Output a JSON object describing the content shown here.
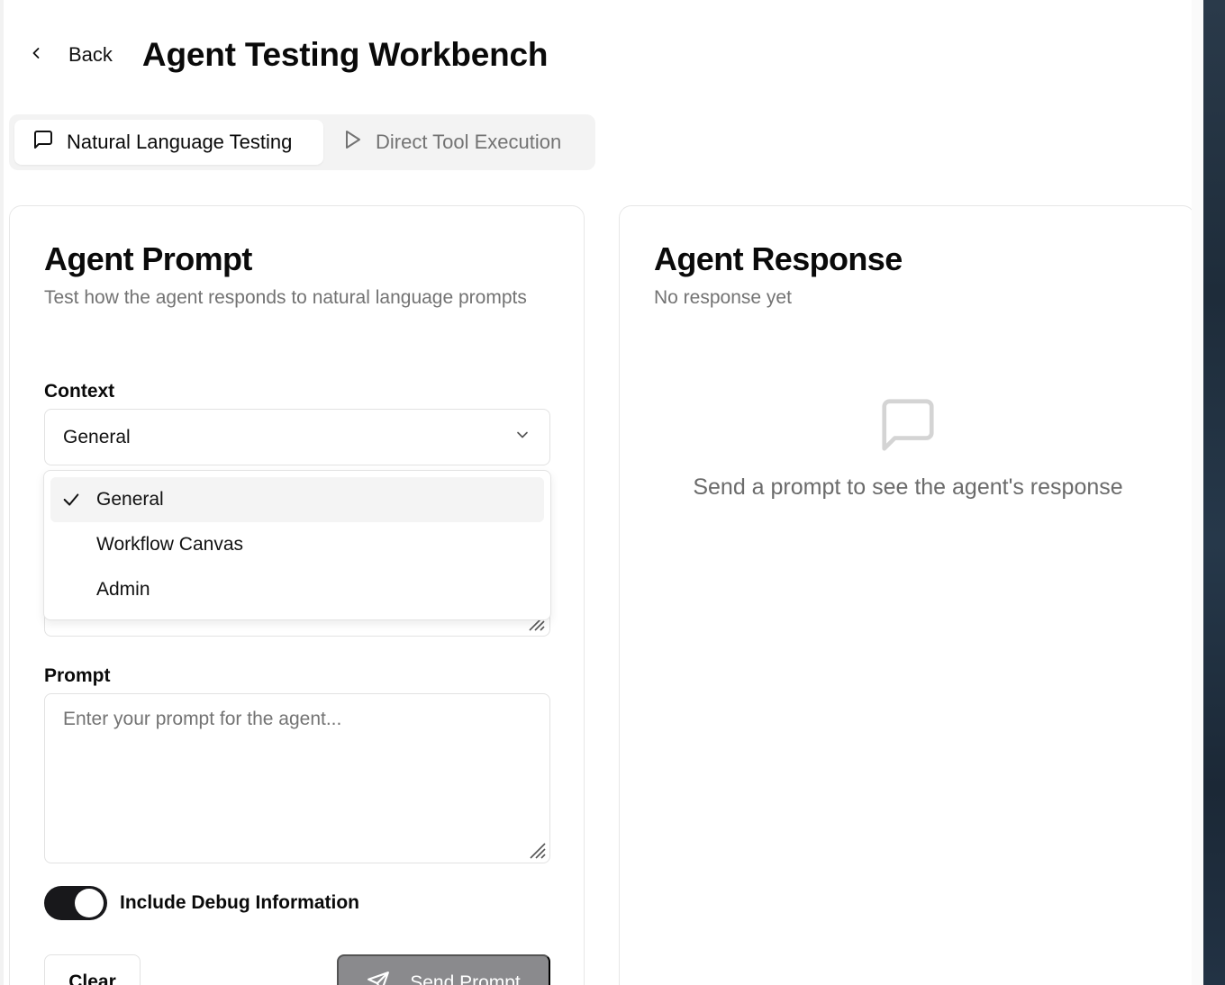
{
  "header": {
    "back_label": "Back",
    "title": "Agent Testing Workbench"
  },
  "tabs": [
    {
      "label": "Natural Language Testing",
      "icon": "message-square-icon",
      "active": true
    },
    {
      "label": "Direct Tool Execution",
      "icon": "play-icon",
      "active": false
    }
  ],
  "prompt_card": {
    "title": "Agent Prompt",
    "description": "Test how the agent responds to natural language prompts",
    "context_label": "Context",
    "context_value": "General",
    "context_options": [
      {
        "label": "General",
        "selected": true
      },
      {
        "label": "Workflow Canvas",
        "selected": false
      },
      {
        "label": "Admin",
        "selected": false
      }
    ],
    "prompt_label": "Prompt",
    "prompt_placeholder": "Enter your prompt for the agent...",
    "debug_label": "Include Debug Information",
    "debug_enabled": true,
    "clear_label": "Clear",
    "send_label": "Send Prompt"
  },
  "response_card": {
    "title": "Agent Response",
    "description": "No response yet",
    "empty_message": "Send a prompt to see the agent's response"
  },
  "colors": {
    "toggle_on": "#18181b",
    "send_button_disabled": "#8a8a8d",
    "muted_text": "#737373"
  }
}
